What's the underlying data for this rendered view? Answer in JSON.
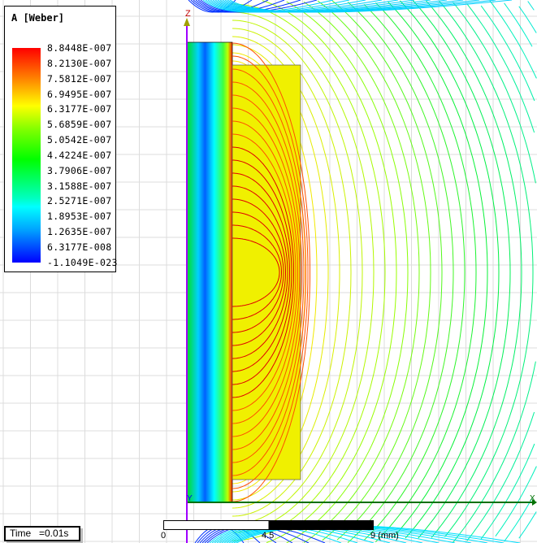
{
  "legend": {
    "title": "A [Weber]",
    "ticks": [
      "8.8448E-007",
      "8.2130E-007",
      "7.5812E-007",
      "6.9495E-007",
      "6.3177E-007",
      "5.6859E-007",
      "5.0542E-007",
      "4.4224E-007",
      "3.7906E-007",
      "3.1588E-007",
      "2.5271E-007",
      "1.8953E-007",
      "1.2635E-007",
      "6.3177E-008",
      "-1.1049E-023"
    ]
  },
  "time": {
    "label": "Time",
    "value": "=0.01s"
  },
  "scale": {
    "labels": [
      "0",
      "4.5",
      "9 (mm)"
    ]
  },
  "axes": {
    "z": "Z",
    "x": "X",
    "y": "Y"
  },
  "colors": {
    "grid": "#dcdcdc",
    "axis": "#007000",
    "zaxis": "#a000ff"
  }
}
